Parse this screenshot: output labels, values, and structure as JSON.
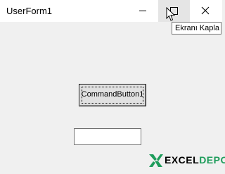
{
  "window": {
    "title": "UserForm1",
    "tooltip": "Ekranı Kapla"
  },
  "form": {
    "command_button_label": "CommandButton1",
    "textbox_value": ""
  },
  "logo": {
    "part1": "EXCEL",
    "part2": "DEPO",
    "accent_color": "#1e9c5b"
  },
  "colors": {
    "form_background": "#f0f0f0",
    "titlebar_background": "#ffffff",
    "hover_button": "#e5e5e5"
  }
}
